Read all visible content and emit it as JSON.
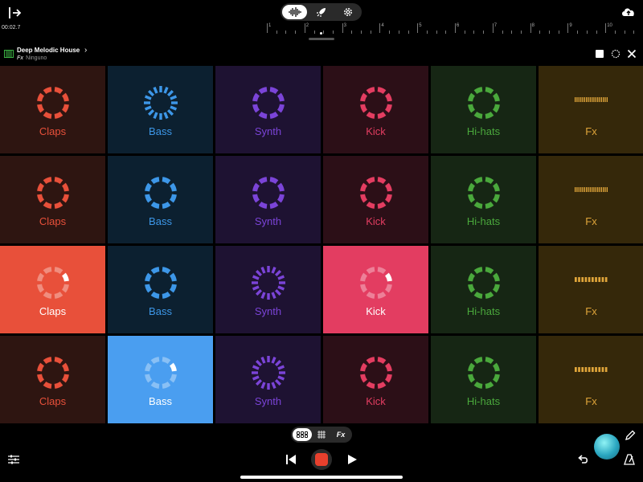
{
  "topbar": {
    "exit_icon": "exit-icon",
    "modes": [
      {
        "icon": "waveform-icon",
        "active": true
      },
      {
        "icon": "rocket-icon",
        "active": false
      },
      {
        "icon": "gear-icon",
        "active": false
      }
    ],
    "cloud_icon": "cloud-upload-icon"
  },
  "timeline": {
    "time": "00:02.7",
    "ruler": [
      "1",
      "2",
      "3",
      "4",
      "5",
      "6",
      "7",
      "8",
      "9",
      "10"
    ]
  },
  "track": {
    "name": "Deep Melodic House",
    "fx_tag": "Fx",
    "author": "Ninguno"
  },
  "colors": {
    "Claps": "#e8503a",
    "Bass": "#3d97e8",
    "Synth": "#7b44d8",
    "Kick": "#e33d61",
    "Hi-hats": "#4aa83c",
    "Fx": "#e0a53a"
  },
  "pads": [
    {
      "label": "Claps",
      "style": "ring",
      "active": false
    },
    {
      "label": "Bass",
      "style": "dashes",
      "active": false
    },
    {
      "label": "Synth",
      "style": "ring",
      "active": false
    },
    {
      "label": "Kick",
      "style": "ring",
      "active": false
    },
    {
      "label": "Hi-hats",
      "style": "ring",
      "active": false
    },
    {
      "label": "Fx",
      "style": "bars-dense",
      "active": false
    },
    {
      "label": "Claps",
      "style": "ring",
      "active": false
    },
    {
      "label": "Bass",
      "style": "ring",
      "active": false
    },
    {
      "label": "Synth",
      "style": "ring",
      "active": false
    },
    {
      "label": "Kick",
      "style": "ring",
      "active": false
    },
    {
      "label": "Hi-hats",
      "style": "ring",
      "active": false
    },
    {
      "label": "Fx",
      "style": "bars-dense",
      "active": false
    },
    {
      "label": "Claps",
      "style": "ring",
      "active": true,
      "bg": "#e8503a"
    },
    {
      "label": "Bass",
      "style": "ring",
      "active": false
    },
    {
      "label": "Synth",
      "style": "dashes",
      "active": false
    },
    {
      "label": "Kick",
      "style": "ring",
      "active": true,
      "bg": "#e33d61"
    },
    {
      "label": "Hi-hats",
      "style": "ring",
      "active": false
    },
    {
      "label": "Fx",
      "style": "bars-sparse",
      "active": false
    },
    {
      "label": "Claps",
      "style": "ring",
      "active": false
    },
    {
      "label": "Bass",
      "style": "ring",
      "active": true,
      "bg": "#4a9ef0"
    },
    {
      "label": "Synth",
      "style": "dashes",
      "active": false
    },
    {
      "label": "Kick",
      "style": "ring",
      "active": false
    },
    {
      "label": "Hi-hats",
      "style": "ring",
      "active": false
    },
    {
      "label": "Fx",
      "style": "bars-sparse",
      "active": false
    }
  ],
  "bottom": {
    "view_switch": [
      {
        "icon": "pads-view-icon",
        "active": true
      },
      {
        "icon": "sequencer-grid-icon",
        "active": false
      },
      {
        "label": "Fx",
        "active": false
      }
    ],
    "mixer_icon": "mixer-sliders-icon",
    "rewind_icon": "skip-back-icon",
    "record_icon": "record-icon",
    "play_icon": "play-icon",
    "pencil_icon": "pencil-icon",
    "undo_icon": "undo-icon",
    "metronome_icon": "metronome-icon"
  }
}
